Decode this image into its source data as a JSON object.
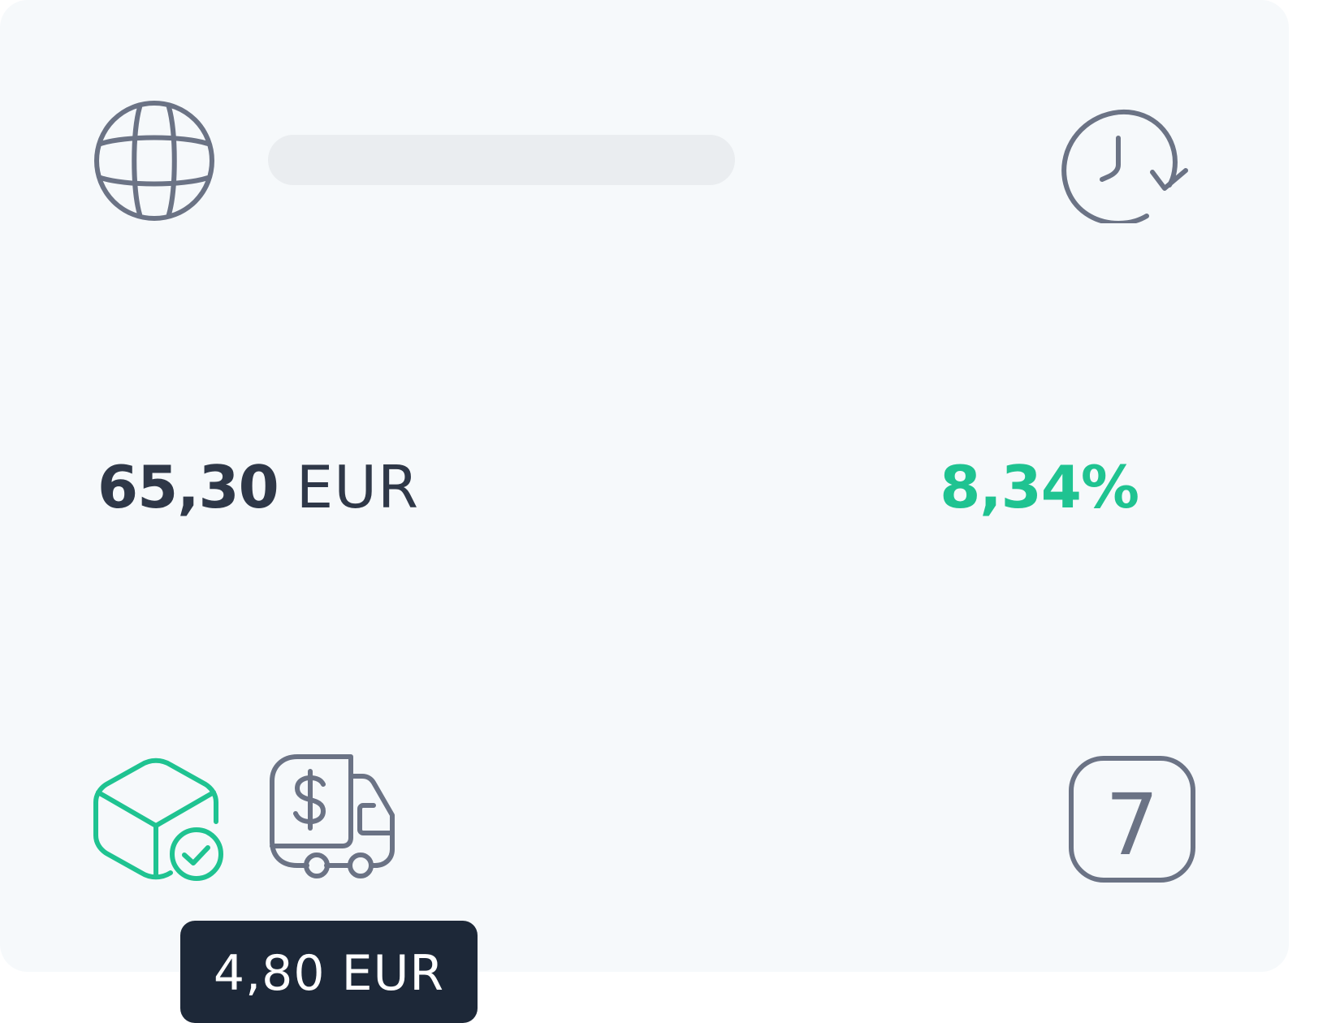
{
  "card": {
    "price": {
      "amount": "65,30",
      "currency": "EUR"
    },
    "percentage": "8,34%",
    "badge_number": "7",
    "tooltip": {
      "shipping_cost": "4,80 EUR"
    },
    "icons": {
      "top_left": "globe-icon",
      "top_right": "history-icon",
      "bottom_left_1": "package-check-icon",
      "bottom_left_2": "delivery-truck-dollar-icon",
      "bottom_right": "number-seven-icon"
    }
  },
  "colors": {
    "card_background": "#f6f9fb",
    "icon_gray": "#6b7385",
    "accent_green": "#1fc391",
    "text_dark": "#2f3848",
    "tooltip_background": "#1d2838",
    "skeleton": "#eaedf0"
  }
}
